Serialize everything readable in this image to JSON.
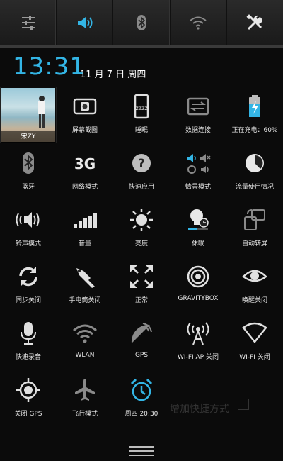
{
  "topbar": {
    "items": [
      {
        "icon": "settings-sliders-icon"
      },
      {
        "icon": "volume-icon",
        "color": "#33b5e5"
      },
      {
        "icon": "bluetooth-icon"
      },
      {
        "icon": "wifi-icon"
      },
      {
        "icon": "tools-icon"
      }
    ]
  },
  "clock": {
    "time": "13:31",
    "date": "11 月 7 日 周四",
    "color": "#33b5e5"
  },
  "user": {
    "name": "宋ZY"
  },
  "tiles": [
    {
      "label": "屏幕截图",
      "icon": "screenshot-icon"
    },
    {
      "label": "睡眠",
      "icon": "sleep-icon"
    },
    {
      "label": "数据连接",
      "icon": "data-connection-icon"
    },
    {
      "label": "正在充电：60%",
      "icon": "battery-charging-icon"
    },
    {
      "label": "蓝牙",
      "icon": "bluetooth-icon"
    },
    {
      "label": "网络模式",
      "icon": "network-mode-icon",
      "glyph": "3G"
    },
    {
      "label": "快速应用",
      "icon": "quick-app-icon"
    },
    {
      "label": "情景模式",
      "icon": "profile-mode-icon"
    },
    {
      "label": "流量使用情况",
      "icon": "data-usage-icon"
    },
    {
      "label": "铃声模式",
      "icon": "ringer-mode-icon"
    },
    {
      "label": "音量",
      "icon": "volume-bars-icon"
    },
    {
      "label": "亮度",
      "icon": "brightness-icon"
    },
    {
      "label": "休眠",
      "icon": "screen-timeout-icon"
    },
    {
      "label": "自动转屏",
      "icon": "auto-rotate-icon"
    },
    {
      "label": "同步关闭",
      "icon": "sync-icon"
    },
    {
      "label": "手电筒关闭",
      "icon": "flashlight-icon"
    },
    {
      "label": "正常",
      "icon": "expand-icon"
    },
    {
      "label": "GRAVITYBOX",
      "icon": "gravitybox-icon"
    },
    {
      "label": "唤醒关闭",
      "icon": "eye-icon"
    },
    {
      "label": "快速录音",
      "icon": "microphone-icon"
    },
    {
      "label": "WLAN",
      "icon": "wlan-icon"
    },
    {
      "label": "GPS",
      "icon": "gps-satellite-icon"
    },
    {
      "label": "WI-FI AP 关闭",
      "icon": "wifi-ap-icon"
    },
    {
      "label": "WI-FI 关闭",
      "icon": "wifi-off-icon"
    },
    {
      "label": "关闭 GPS",
      "icon": "gps-locate-icon"
    },
    {
      "label": "飞行模式",
      "icon": "airplane-icon"
    },
    {
      "label": "周四 20:30",
      "icon": "alarm-icon",
      "color": "#33b5e5"
    }
  ],
  "ghost_text": "增加快捷方式"
}
